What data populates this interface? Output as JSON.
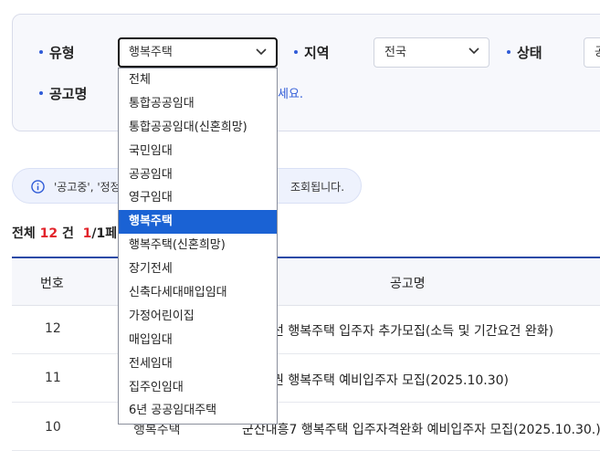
{
  "filters": {
    "type_label": "유형",
    "type_selected": "행복주택",
    "region_label": "지역",
    "region_selected": "전국",
    "status_label": "상태",
    "status_selected_partial": "공",
    "name_label": "공고명",
    "name_hint_partial": "세요."
  },
  "dropdown": {
    "options": [
      "전체",
      "통합공공임대",
      "통합공공임대(신혼희망)",
      "국민임대",
      "공공임대",
      "영구임대",
      "행복주택",
      "행복주택(신혼희망)",
      "장기전세",
      "신축다세대매입임대",
      "가정어린이집",
      "매입임대",
      "전세임대",
      "집주인임대",
      "6년 공공임대주택"
    ],
    "selected_index": 6
  },
  "notice": {
    "text_start": "'공고중', '정정",
    "text_end": "조회됩니다."
  },
  "summary": {
    "total_label": "전체",
    "total_count": "12",
    "unit": "건",
    "current_page": "1",
    "page_rest": "/1페이"
  },
  "table": {
    "headers": {
      "num": "번호",
      "title": "공고명"
    },
    "rows": [
      {
        "num": "12",
        "type": "",
        "title": "선 행복주택 입주자 추가모집(소득 및 기간요건 완화)"
      },
      {
        "num": "11",
        "type": "",
        "title": "권 행복주택 예비입주자 모집(2025.10.30)"
      },
      {
        "num": "10",
        "type": "행복주택",
        "title": "군산내흥7 행복주택 입주자격완화 예비입주자 모집(2025.10.30.)"
      }
    ]
  }
}
